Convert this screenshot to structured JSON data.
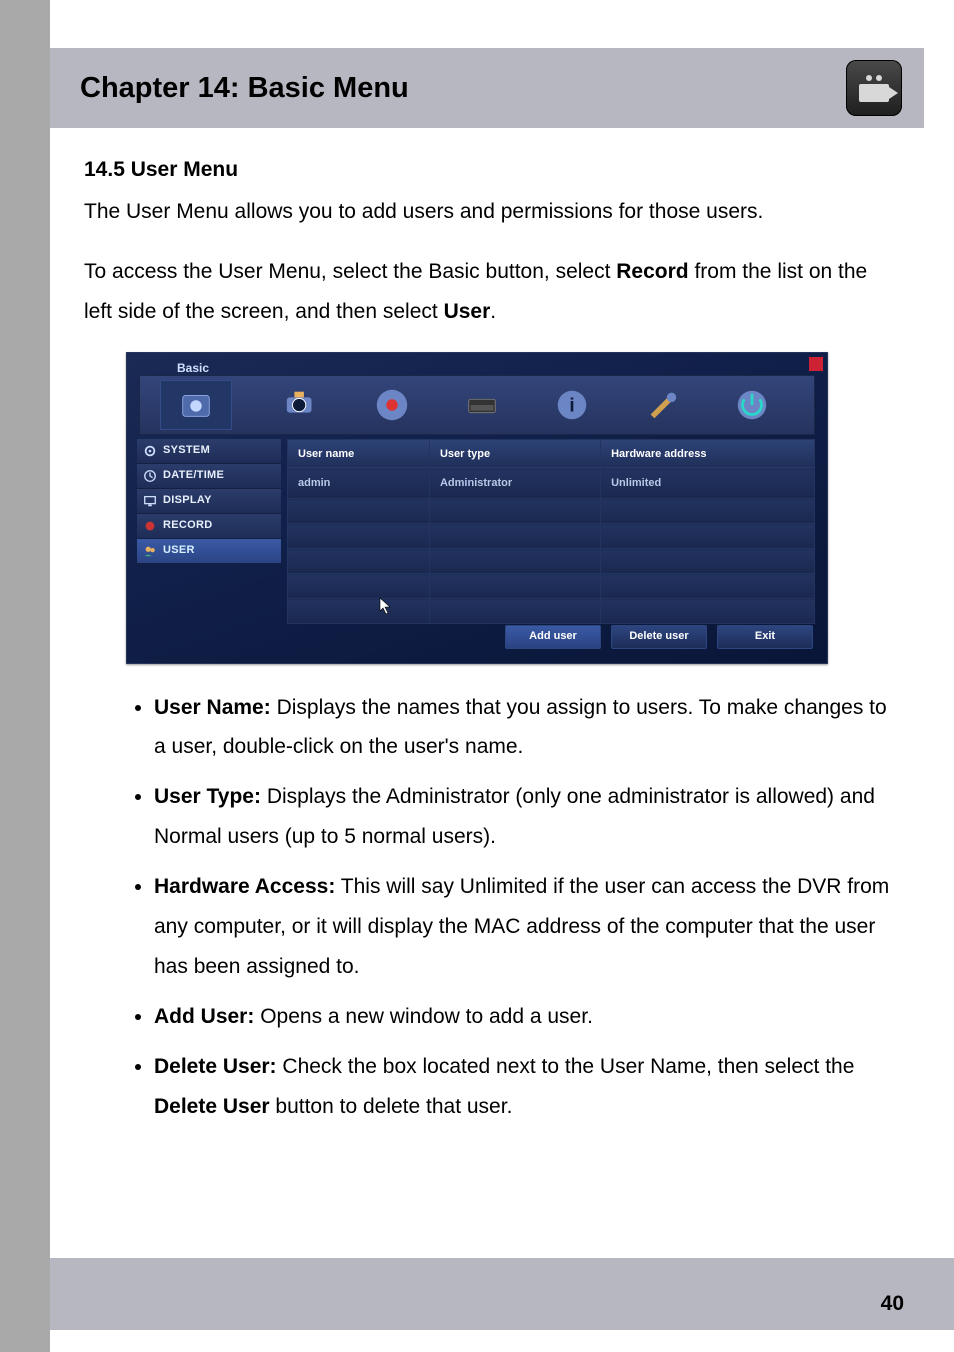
{
  "header": {
    "title": "Chapter 14: Basic Menu",
    "icon": "camera-icon"
  },
  "section": {
    "heading": "14.5 User Menu",
    "intro": "The User Menu allows you to add users and permissions for those users.",
    "access_pre": "To access the User Menu, select the Basic button, select ",
    "access_bold1": "Record",
    "access_mid": " from the list on the left side of the screen, and then select ",
    "access_bold2": "User",
    "access_end": "."
  },
  "dvr": {
    "title": "Basic",
    "sidebar": [
      {
        "icon": "gear-icon",
        "label": "SYSTEM"
      },
      {
        "icon": "clock-icon",
        "label": "DATE/TIME"
      },
      {
        "icon": "monitor-icon",
        "label": "DISPLAY"
      },
      {
        "icon": "record-icon",
        "label": "RECORD"
      },
      {
        "icon": "users-icon",
        "label": "USER"
      }
    ],
    "table": {
      "headers": [
        "User name",
        "User type",
        "Hardware address"
      ],
      "rows": [
        [
          "admin",
          "Administrator",
          "Unlimited"
        ],
        [
          "",
          "",
          ""
        ],
        [
          "",
          "",
          ""
        ],
        [
          "",
          "",
          ""
        ],
        [
          "",
          "",
          ""
        ],
        [
          "",
          "",
          ""
        ]
      ]
    },
    "buttons": {
      "add": "Add user",
      "delete": "Delete user",
      "exit": "Exit"
    }
  },
  "bullets": [
    {
      "term": "User Name:",
      "text": " Displays the names that you assign to users. To make changes to a user, double-click on the user's name."
    },
    {
      "term": "User Type:",
      "text": " Displays the Administrator (only one administrator is allowed) and Normal users (up to 5 normal users)."
    },
    {
      "term": "Hardware Access:",
      "text": " This will say Unlimited if the user can access the DVR from any computer, or it will display the MAC address of the computer that the user has been assigned to."
    },
    {
      "term": "Add User:",
      "text": " Opens a new window to add a user."
    },
    {
      "term": "Delete User:",
      "pre": " Check the box located next to the User Name, then select the ",
      "bold": "Delete User",
      "post": " button to delete that user."
    }
  ],
  "page_number": "40"
}
